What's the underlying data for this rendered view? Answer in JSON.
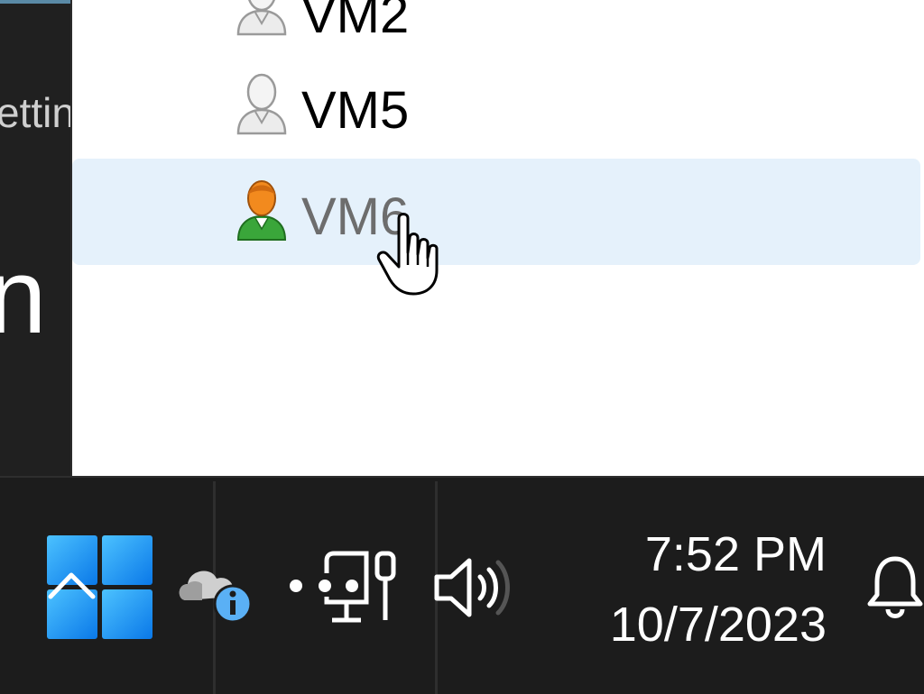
{
  "left_window": {
    "label_fragment": "ettin",
    "heading_fragment": "n"
  },
  "vm_list": {
    "items": [
      {
        "name": "VM2",
        "state": "offline"
      },
      {
        "name": "VM5",
        "state": "offline"
      },
      {
        "name": "VM6",
        "state": "online",
        "selected": true
      }
    ]
  },
  "taskbar": {
    "start_icon": "windows-start-icon",
    "tray": {
      "weather_icon": "cloud-info-icon",
      "network_icon": "ethernet-icon",
      "volume_icon": "speaker-icon"
    },
    "clock": {
      "time": "7:52 PM",
      "date": "10/7/2023"
    },
    "notifications_icon": "bell-icon"
  },
  "colors": {
    "selection": "#e5f1fb",
    "taskbar": "#1c1c1c",
    "start_accent": "#1e9bf0",
    "online_user": "#f28a1e",
    "online_body": "#3aa63a"
  }
}
